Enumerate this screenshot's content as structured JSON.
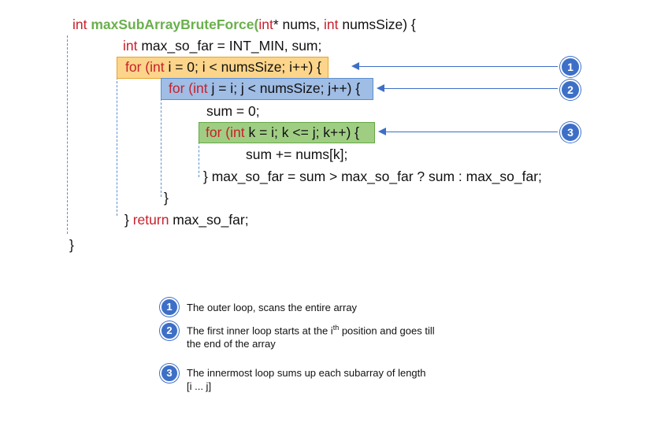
{
  "code": {
    "line1": {
      "kw1": "int",
      "fn": "maxSubArrayBruteForce(",
      "kw2": "int",
      "rest1": "* nums, ",
      "kw3": "int",
      "rest2": " numsSize) {"
    },
    "line2": {
      "kw": "int",
      "rest": " max_so_far = INT_MIN, sum;"
    },
    "line3": {
      "kw1": "for (",
      "kw2": "int",
      "rest": " i = 0; i < numsSize; i++) {"
    },
    "line4": {
      "kw1": "for (",
      "kw2": "int",
      "rest": " j = i; j < numsSize; j++) {"
    },
    "line5": {
      "text": "sum = 0;"
    },
    "line6": {
      "kw1": "for (",
      "kw2": "int",
      "rest": " k = i; k <= j; k++) {"
    },
    "line7": {
      "text": "sum += nums[k];"
    },
    "line8": {
      "text": "} max_so_far = sum > max_so_far ? sum : max_so_far;"
    },
    "line9": {
      "text": "}"
    },
    "line10": {
      "pre": "} ",
      "kw": "return",
      "rest": " max_so_far;"
    },
    "line11": {
      "text": "}"
    }
  },
  "colors": {
    "outer_loop_fill": "#fcd58a",
    "outer_loop_border": "#e8a32c",
    "inner_loop_fill": "#9fbde5",
    "inner_loop_border": "#5b8fd0",
    "innermost_loop_fill": "#9fce83",
    "innermost_loop_border": "#64a845",
    "keyword": "#c8202b",
    "function_name": "#6ab04c",
    "marker": "#3d6fc7"
  },
  "markers": [
    "1",
    "2",
    "3"
  ],
  "legend": [
    {
      "num": "1",
      "text": "The outer loop, scans the entire array"
    },
    {
      "num": "2",
      "text_a": "The first inner loop starts at the i",
      "sup": "th",
      "text_b": " position and goes till",
      "text_c": "the end of the array"
    },
    {
      "num": "3",
      "text_a": "The innermost loop sums up each subarray of length",
      "text_b": "[i ... j]"
    }
  ]
}
